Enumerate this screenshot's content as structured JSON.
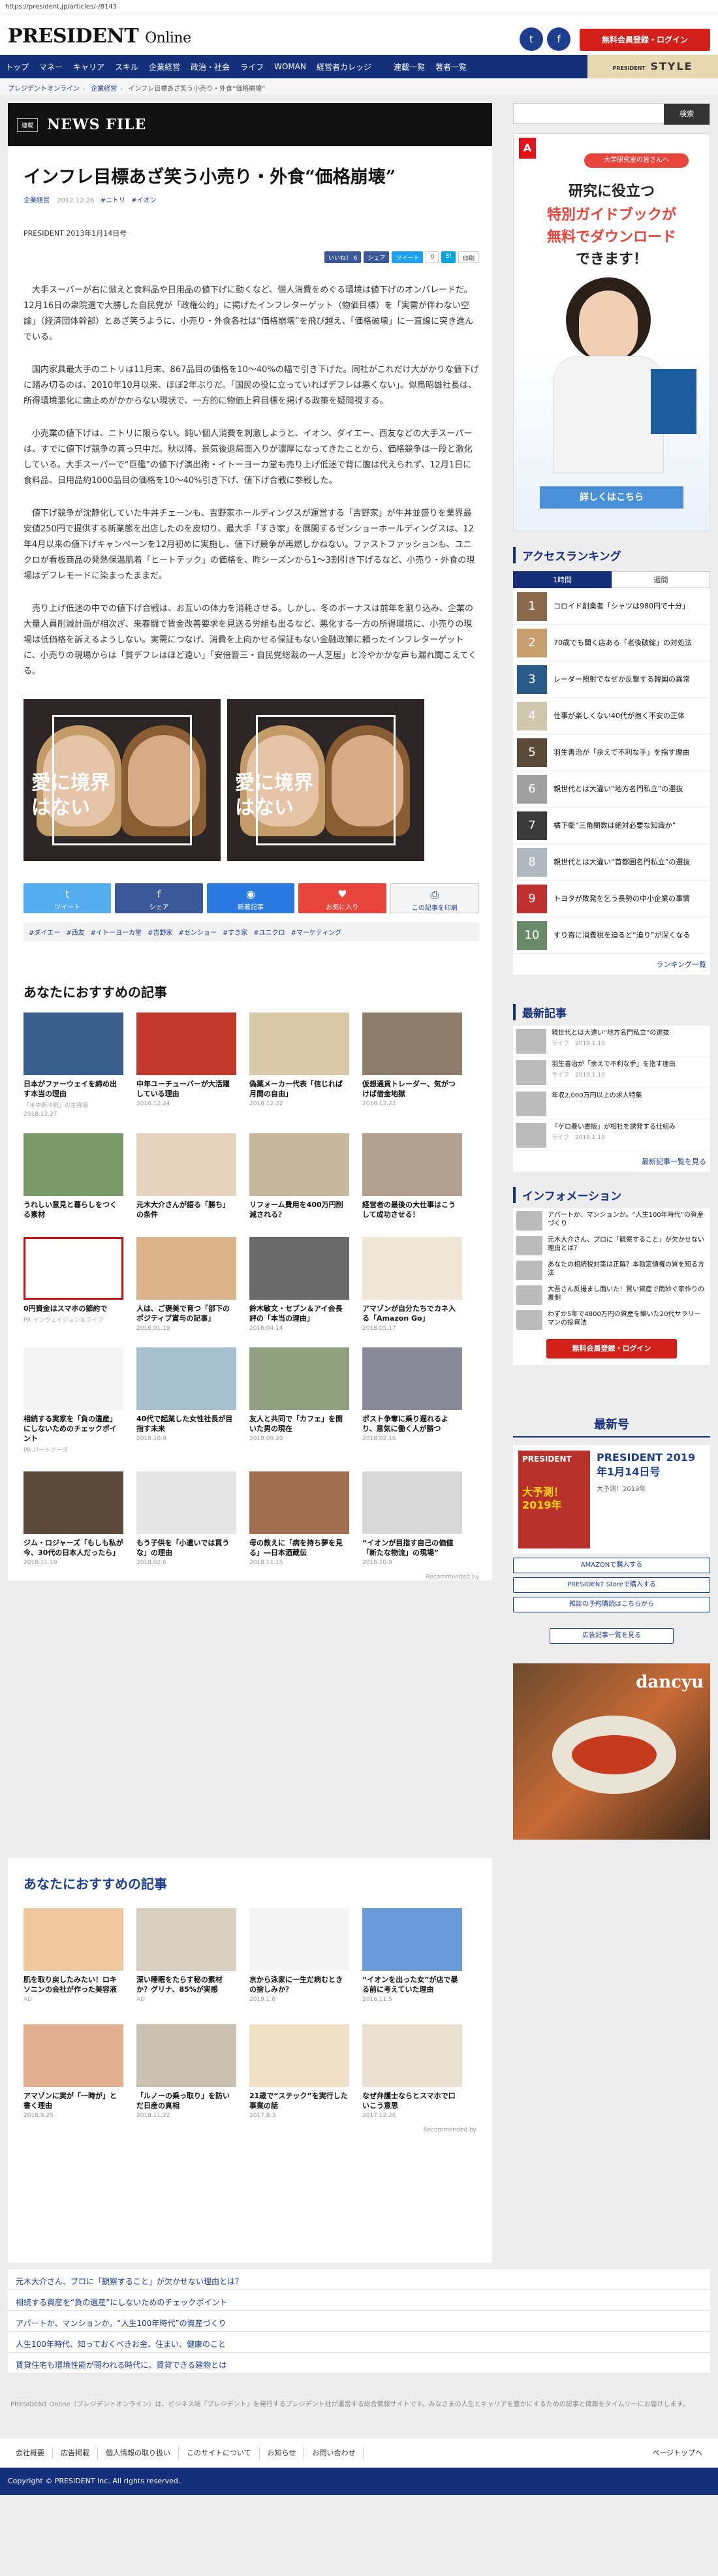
{
  "browser": {
    "url": "https://president.jp/articles/-/8143"
  },
  "header": {
    "logo_main": "PRESIDENT",
    "logo_sub": "Online",
    "cta": "無料会員登録・ログイン"
  },
  "nav": {
    "items": [
      "トップ",
      "マネー",
      "キャリア",
      "スキル",
      "企業経営",
      "政治・社会",
      "ライフ",
      "WOMAN",
      "経営者カレッジ",
      "連載一覧",
      "著者一覧"
    ],
    "style_label": "STYLE"
  },
  "breadcrumb": [
    "プレジデントオンライン",
    "企業経営",
    "インフレ目標あざ笑う小売り・外食“価格崩壊”"
  ],
  "section_badge": "連載",
  "section_title": "NEWS FILE",
  "article": {
    "title": "インフレ目標あざ笑う小売り・外食“価格崩壊”",
    "category": "企業経営",
    "date": "2012.12.26",
    "tags_inline": [
      "#ニトリ",
      "#イオン"
    ],
    "pub_date": "PRESIDENT 2013年1月14日号",
    "share_top": [
      "いいね！ 6",
      "シェア",
      "ツイート",
      "0",
      "B!",
      "印刷"
    ],
    "paragraphs": [
      "大手スーパーが右に倣えと食料品や日用品の値下げに動くなど、個人消費をめぐる環境は値下げのオンパレードだ。12月16日の衆院選で大勝した自民党が「政権公約」に掲げたインフレターゲット（物価目標）を「実需が伴わない空論」（経済団体幹部）とあざ笑うように、小売り・外食各社は“価格崩壊”を飛び越え、「価格破壊」に一直線に突き進んでいる。",
      "国内家具最大手のニトリは11月末、867品目の価格を10～40%の幅で引き下げた。同社がこれだけ大がかりな値下げに踏み切るのは、2010年10月以来、ほぼ2年ぶりだ。「国民の役に立っていればデフレは悪くない」。似鳥昭雄社長は、所得環境悪化に歯止めがかからない現状で、一方的に物価上昇目標を掲げる政策を疑問視する。",
      "小売業の値下げは、ニトリに限らない。鈍い個人消費を刺激しようと、イオン、ダイエー、西友などの大手スーパーは、すでに値下げ競争の真っ只中だ。秋以降、景気後退局面入りが濃厚になってきたことから、価格競争は一段と激化している。大手スーパーで“巨艦”の値下げ演出術・イトーヨーカ堂も売り上げ低迷で背に腹は代えられず、12月1日に食料品、日用品約1000品目の価格を10～40%引き下げ、値下げ合戦に参戦した。",
      "値下げ競争が沈静化していた牛丼チェーンも、吉野家ホールディングスが運営する「吉野家」が牛丼並盛りを業界最安値250円で提供する新業態を出店したのを皮切り、最大手「すき家」を展開するゼンショーホールディングスは、12年4月以来の値下げキャンペーンを12月初めに実施し、値下げ競争が再燃しかねない。ファストファッションも、ユニクロが看板商品の発熱保温肌着「ヒートテック」の価格を、昨シーズンから1～3割引き下げるなど、小売り・外食の現場はデフレモードに染まったままだ。",
      "売り上げ低迷の中での値下げ合戦は、お互いの体力を消耗させる。しかし、冬のボーナスは前年を割り込み、企業の大量人員削減計画が相次ぎ、来春闘で賃金改善要求を見送る労組も出るなど、悪化する一方の所得環境に、小売りの現場は低価格を訴えるようしない。実需につなげ、消費を上向かせる保証もない金融政策に頼ったインフレターゲットに、小売りの現場からは「貧デフレはほど遠い」「安倍晋三・自民党総裁の一人芝居」と冷やかかな声も漏れ聞こえてくる。"
    ],
    "image_caption": "愛に境界はない",
    "share_buttons": [
      "ツイート",
      "シェア",
      "新着記事",
      "お気に入り",
      "この記事を印刷"
    ],
    "tags": [
      "#ダイエー",
      "#西友",
      "#イトーヨーカ堂",
      "#吉野家",
      "#ゼンショー",
      "#すき家",
      "#ユニクロ",
      "#マーケティング"
    ]
  },
  "recommend1": {
    "title": "あなたにおすすめの記事",
    "cards": [
      {
        "title": "日本がファーウェイを締め出す本当の理由",
        "meta": "「米中新冷戦」の主戦場",
        "date": "2018.12.27"
      },
      {
        "title": "中年ユーチューバーが大活躍している理由",
        "meta": "",
        "date": "2018.12.24"
      },
      {
        "title": "偽薬メーカー代表「信じれば月間の自由」",
        "meta": "",
        "date": "2018.12.22"
      },
      {
        "title": "仮想通貨トレーダー、気がつけば借金地獄",
        "meta": "",
        "date": "2018.12.22"
      },
      {
        "title": "うれしい意見と暮らしをつくる素材",
        "meta": "",
        "date": ""
      },
      {
        "title": "元木大介さんが語る「勝ち」の条件",
        "meta": "",
        "date": ""
      },
      {
        "title": "リフォーム費用を400万円削減される？",
        "meta": "",
        "date": ""
      },
      {
        "title": "経営者の最後の大仕事はこうして成功させる！",
        "meta": "",
        "date": ""
      },
      {
        "title": "0円資金はスマホの節約で",
        "meta": "PR インヴェイジョン＆ライフ",
        "date": ""
      },
      {
        "title": "人は、ご褒美で育つ「部下のポジティブ賞与の記事」",
        "meta": "",
        "date": "2016.01.19"
      },
      {
        "title": "鈴木敏文・セブン＆アイ会長評の「本当の理由」",
        "meta": "",
        "date": "2016.04.14"
      },
      {
        "title": "アマゾンが自分たちでカネ入る「Amazon Go」",
        "meta": "",
        "date": "2018.05.17"
      },
      {
        "title": "相続する実家を「負の遺産」にしないためのチェックポイント",
        "meta": "PR パートナーズ",
        "date": ""
      },
      {
        "title": "40代で起業した女性社長が目指す未来",
        "meta": "",
        "date": "2018.10.9"
      },
      {
        "title": "友人と共同で「カフェ」を開いた男の現在",
        "meta": "",
        "date": "2018.09.20"
      },
      {
        "title": "ポスト争奪に乗り遅れるより、意気に働く人が勝つ",
        "meta": "",
        "date": "2018.02.16"
      },
      {
        "title": "ジム・ロジャーズ「もしも私が今、30代の日本人だったら」",
        "meta": "",
        "date": "2018.11.19"
      },
      {
        "title": "もう子供を「小遣いでは買うな」の理由",
        "meta": "",
        "date": "2018.02.6"
      },
      {
        "title": "母の教えに「病を持ち夢を見る」―日本酒蔵伝",
        "meta": "",
        "date": "2018.11.15"
      },
      {
        "title": "“イオンが目指す自己の価値「新たな物流」の現場”",
        "meta": "",
        "date": "2018.10.9"
      }
    ],
    "recommended_by": "Recommended by"
  },
  "recommend2": {
    "title": "あなたにおすすめの記事",
    "cards": [
      {
        "title": "肌を取り戻したみたい！ロキソニンの会社が作った美容液",
        "meta": "AD",
        "date": ""
      },
      {
        "title": "深い睡眠をたらす秘の素材か？グリナ、85%が実感",
        "meta": "AD",
        "date": ""
      },
      {
        "title": "京から泳家に一生だ病むときの捨しみか？",
        "meta": "",
        "date": "2019.1.8"
      },
      {
        "title": "“イオンを出った女”が店で暴る前に考えていた理由",
        "meta": "",
        "date": "2016.11.5"
      },
      {
        "title": "アマゾンに実が「一時が」と書く理由",
        "meta": "",
        "date": "2018.9.25"
      },
      {
        "title": "「ルノーの乗っ取り」を防いだ日産の真相",
        "meta": "",
        "date": "2018.11.22"
      },
      {
        "title": "21歳で“ステック”を実行した事業の話",
        "meta": "",
        "date": "2017.8.3"
      },
      {
        "title": "なぜ弁護士ならとスマホで口いこう意思",
        "meta": "",
        "date": "2017.12.26"
      }
    ],
    "recommended_by": "Recommended by"
  },
  "bottom_links": [
    "元木大介さん、プロに「観察すること」が欠かせない理由とは？",
    "相続する資産を“負の遺産”にしないためのチェックポイント",
    "アパートか、マンションか。“人生100年時代”の資産づくり",
    "人生100年時代、知っておくべきお金、住まい、健康のこと",
    "賃貸住宅も環境性能が問われる時代に。賃貸できる建物とは"
  ],
  "footer": {
    "desc": "PRESIDENT Online（プレジデントオンライン）は、ビジネス誌『プレジデント』を発行するプレジデント社が運営する総合情報サイトです。みなさまの人生とキャリアを豊かにするための記事と情報をタイムリーにお届けします。",
    "nav": [
      "会社概要",
      "広告掲載",
      "個人情報の取り扱い",
      "このサイトについて",
      "お知らせ",
      "お問い合わせ"
    ],
    "page_top": "ページトップへ",
    "copyright": "Copyright © PRESIDENT Inc. All rights reserved."
  },
  "sidebar": {
    "search": "検索",
    "ad": {
      "pill": "大学研究室の皆さんへ",
      "line1": "研究に役立つ",
      "line2": "特別ガイドブックが",
      "line3": "無料でダウンロード",
      "line4": "できます！",
      "button": "詳しくはこちら"
    },
    "ranking": {
      "title": "アクセスランキング",
      "tabs": [
        "1時間",
        "週間"
      ],
      "items": [
        "コロイド創業者「シャツは980円で十分」",
        "70歳でも聞く店ある「老後破綻」の対処法",
        "レーダー照射でなぜか反撃する韓国の異常",
        "仕事が楽しくない40代が抱く不安の正体",
        "羽生善治が「余えで不利な手」を指す理由",
        "親世代とは大違い“地方名門私立”の選抜",
        "橘下衛“三角関数は絶対必要な知識か”",
        "親世代とは大違い“首都圏名門私立”の選抜",
        "トヨタが敗発を乞う長勢の中小企業の事情",
        "すり寄に消費税を迫るど“迫り”が深くなる"
      ],
      "more": "ランキング一覧"
    },
    "latest": {
      "title": "最新記事",
      "items": [
        {
          "title": "親世代とは大違い“地方名門私立”の選抜",
          "meta": "ライフ　2019.1.10"
        },
        {
          "title": "羽生善治が「余えで不利な手」を指す理由",
          "meta": "ライフ　2019.1.10"
        },
        {
          "title": "年収2,000万円以上の求人特集",
          "meta": ""
        },
        {
          "title": "「ゲロ養い書販」が相社を誘発する仕組み",
          "meta": "ライフ　2019.1.10"
        }
      ],
      "more": "最新記事一覧を見る"
    },
    "info": {
      "title": "インフォメーション",
      "items": [
        "アパートか、マンションか。“人生100年時代”の資産づくり",
        "元木大介さん、プロに「観察すること」が欠かせない理由とは？",
        "あなたの相続税対策は正解？本勘定債権の質を知る方法",
        "大吾さん反撮まし面いた！賢い資産で雨紗ぐ家作りの裏側",
        "わずか5年で4800万円の資産を築いた20代サラリーマンの投資法"
      ],
      "cta": "無料会員登録・ログイン"
    },
    "magazine": {
      "title": "最新号",
      "cover_text": "大予測！2019年",
      "issue": "PRESIDENT 2019年1月14日号",
      "issue_sub": "大予測！2019年",
      "buttons": [
        "AMAZONで購入する",
        "PRESIDENT Storeで購入する",
        "雑誌の予約購読はこちらから"
      ],
      "ad_link": "広告記事一覧を見る",
      "ad_brand": "dancyu"
    }
  }
}
